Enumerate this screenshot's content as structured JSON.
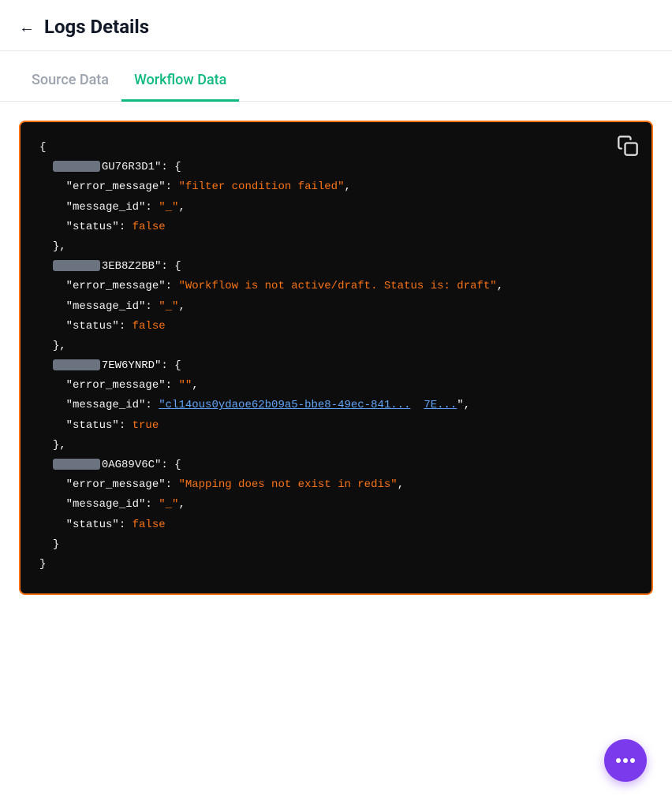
{
  "header": {
    "back_label": "←",
    "title": "Logs Details"
  },
  "tabs": [
    {
      "id": "source",
      "label": "Source Data",
      "active": false
    },
    {
      "id": "workflow",
      "label": "Workflow Data",
      "active": true
    }
  ],
  "code_block": {
    "entries": [
      {
        "id_suffix": "GU76R3D1",
        "error_message": "filter condition failed",
        "message_id": "_",
        "status": "false"
      },
      {
        "id_suffix": "3EB8Z2BB",
        "error_message": "Workflow is not active/draft. Status is: draft",
        "message_id": "_",
        "status": "false"
      },
      {
        "id_suffix": "7EW6YNRD",
        "error_message": "",
        "message_id": "cl14ous0ydaoe62b09a5-bbe8-49ec-84...",
        "message_id_link": true,
        "status": "true"
      },
      {
        "id_suffix": "0AG89V6C",
        "error_message": "Mapping does not exist in redis",
        "message_id": "_",
        "status": "false"
      }
    ]
  },
  "chat_button": {
    "label": "chat"
  },
  "icons": {
    "copy": "copy-icon",
    "back": "back-arrow-icon",
    "chat": "chat-icon"
  }
}
